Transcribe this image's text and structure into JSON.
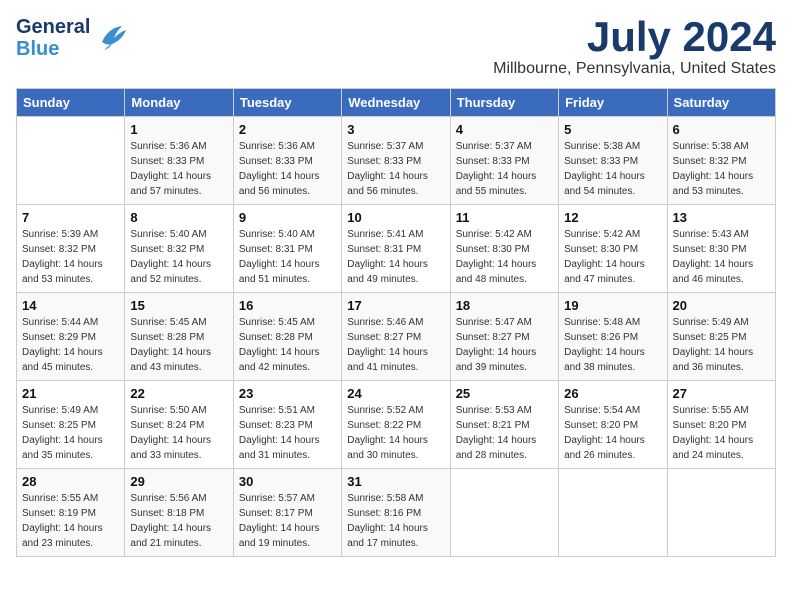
{
  "header": {
    "logo_line1": "General",
    "logo_line2": "Blue",
    "month": "July 2024",
    "location": "Millbourne, Pennsylvania, United States"
  },
  "weekdays": [
    "Sunday",
    "Monday",
    "Tuesday",
    "Wednesday",
    "Thursday",
    "Friday",
    "Saturday"
  ],
  "weeks": [
    [
      {
        "day": "",
        "sunrise": "",
        "sunset": "",
        "daylight": ""
      },
      {
        "day": "1",
        "sunrise": "Sunrise: 5:36 AM",
        "sunset": "Sunset: 8:33 PM",
        "daylight": "Daylight: 14 hours and 57 minutes."
      },
      {
        "day": "2",
        "sunrise": "Sunrise: 5:36 AM",
        "sunset": "Sunset: 8:33 PM",
        "daylight": "Daylight: 14 hours and 56 minutes."
      },
      {
        "day": "3",
        "sunrise": "Sunrise: 5:37 AM",
        "sunset": "Sunset: 8:33 PM",
        "daylight": "Daylight: 14 hours and 56 minutes."
      },
      {
        "day": "4",
        "sunrise": "Sunrise: 5:37 AM",
        "sunset": "Sunset: 8:33 PM",
        "daylight": "Daylight: 14 hours and 55 minutes."
      },
      {
        "day": "5",
        "sunrise": "Sunrise: 5:38 AM",
        "sunset": "Sunset: 8:33 PM",
        "daylight": "Daylight: 14 hours and 54 minutes."
      },
      {
        "day": "6",
        "sunrise": "Sunrise: 5:38 AM",
        "sunset": "Sunset: 8:32 PM",
        "daylight": "Daylight: 14 hours and 53 minutes."
      }
    ],
    [
      {
        "day": "7",
        "sunrise": "Sunrise: 5:39 AM",
        "sunset": "Sunset: 8:32 PM",
        "daylight": "Daylight: 14 hours and 53 minutes."
      },
      {
        "day": "8",
        "sunrise": "Sunrise: 5:40 AM",
        "sunset": "Sunset: 8:32 PM",
        "daylight": "Daylight: 14 hours and 52 minutes."
      },
      {
        "day": "9",
        "sunrise": "Sunrise: 5:40 AM",
        "sunset": "Sunset: 8:31 PM",
        "daylight": "Daylight: 14 hours and 51 minutes."
      },
      {
        "day": "10",
        "sunrise": "Sunrise: 5:41 AM",
        "sunset": "Sunset: 8:31 PM",
        "daylight": "Daylight: 14 hours and 49 minutes."
      },
      {
        "day": "11",
        "sunrise": "Sunrise: 5:42 AM",
        "sunset": "Sunset: 8:30 PM",
        "daylight": "Daylight: 14 hours and 48 minutes."
      },
      {
        "day": "12",
        "sunrise": "Sunrise: 5:42 AM",
        "sunset": "Sunset: 8:30 PM",
        "daylight": "Daylight: 14 hours and 47 minutes."
      },
      {
        "day": "13",
        "sunrise": "Sunrise: 5:43 AM",
        "sunset": "Sunset: 8:30 PM",
        "daylight": "Daylight: 14 hours and 46 minutes."
      }
    ],
    [
      {
        "day": "14",
        "sunrise": "Sunrise: 5:44 AM",
        "sunset": "Sunset: 8:29 PM",
        "daylight": "Daylight: 14 hours and 45 minutes."
      },
      {
        "day": "15",
        "sunrise": "Sunrise: 5:45 AM",
        "sunset": "Sunset: 8:28 PM",
        "daylight": "Daylight: 14 hours and 43 minutes."
      },
      {
        "day": "16",
        "sunrise": "Sunrise: 5:45 AM",
        "sunset": "Sunset: 8:28 PM",
        "daylight": "Daylight: 14 hours and 42 minutes."
      },
      {
        "day": "17",
        "sunrise": "Sunrise: 5:46 AM",
        "sunset": "Sunset: 8:27 PM",
        "daylight": "Daylight: 14 hours and 41 minutes."
      },
      {
        "day": "18",
        "sunrise": "Sunrise: 5:47 AM",
        "sunset": "Sunset: 8:27 PM",
        "daylight": "Daylight: 14 hours and 39 minutes."
      },
      {
        "day": "19",
        "sunrise": "Sunrise: 5:48 AM",
        "sunset": "Sunset: 8:26 PM",
        "daylight": "Daylight: 14 hours and 38 minutes."
      },
      {
        "day": "20",
        "sunrise": "Sunrise: 5:49 AM",
        "sunset": "Sunset: 8:25 PM",
        "daylight": "Daylight: 14 hours and 36 minutes."
      }
    ],
    [
      {
        "day": "21",
        "sunrise": "Sunrise: 5:49 AM",
        "sunset": "Sunset: 8:25 PM",
        "daylight": "Daylight: 14 hours and 35 minutes."
      },
      {
        "day": "22",
        "sunrise": "Sunrise: 5:50 AM",
        "sunset": "Sunset: 8:24 PM",
        "daylight": "Daylight: 14 hours and 33 minutes."
      },
      {
        "day": "23",
        "sunrise": "Sunrise: 5:51 AM",
        "sunset": "Sunset: 8:23 PM",
        "daylight": "Daylight: 14 hours and 31 minutes."
      },
      {
        "day": "24",
        "sunrise": "Sunrise: 5:52 AM",
        "sunset": "Sunset: 8:22 PM",
        "daylight": "Daylight: 14 hours and 30 minutes."
      },
      {
        "day": "25",
        "sunrise": "Sunrise: 5:53 AM",
        "sunset": "Sunset: 8:21 PM",
        "daylight": "Daylight: 14 hours and 28 minutes."
      },
      {
        "day": "26",
        "sunrise": "Sunrise: 5:54 AM",
        "sunset": "Sunset: 8:20 PM",
        "daylight": "Daylight: 14 hours and 26 minutes."
      },
      {
        "day": "27",
        "sunrise": "Sunrise: 5:55 AM",
        "sunset": "Sunset: 8:20 PM",
        "daylight": "Daylight: 14 hours and 24 minutes."
      }
    ],
    [
      {
        "day": "28",
        "sunrise": "Sunrise: 5:55 AM",
        "sunset": "Sunset: 8:19 PM",
        "daylight": "Daylight: 14 hours and 23 minutes."
      },
      {
        "day": "29",
        "sunrise": "Sunrise: 5:56 AM",
        "sunset": "Sunset: 8:18 PM",
        "daylight": "Daylight: 14 hours and 21 minutes."
      },
      {
        "day": "30",
        "sunrise": "Sunrise: 5:57 AM",
        "sunset": "Sunset: 8:17 PM",
        "daylight": "Daylight: 14 hours and 19 minutes."
      },
      {
        "day": "31",
        "sunrise": "Sunrise: 5:58 AM",
        "sunset": "Sunset: 8:16 PM",
        "daylight": "Daylight: 14 hours and 17 minutes."
      },
      {
        "day": "",
        "sunrise": "",
        "sunset": "",
        "daylight": ""
      },
      {
        "day": "",
        "sunrise": "",
        "sunset": "",
        "daylight": ""
      },
      {
        "day": "",
        "sunrise": "",
        "sunset": "",
        "daylight": ""
      }
    ]
  ]
}
